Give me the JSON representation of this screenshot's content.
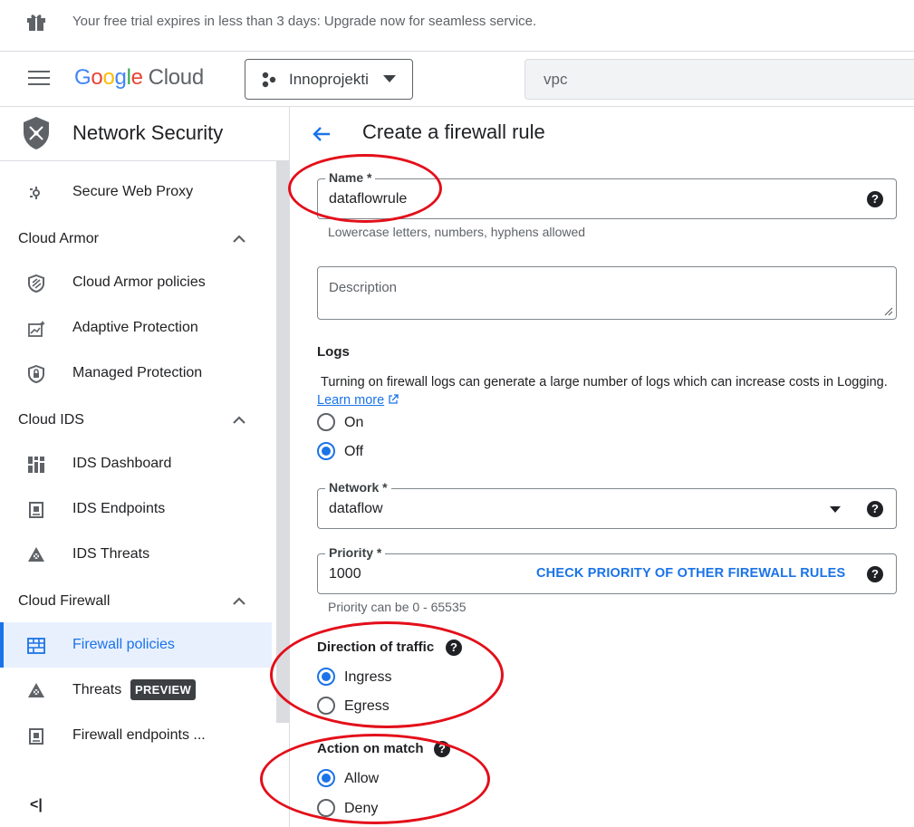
{
  "banner": {
    "text": "Your free trial expires in less than 3 days: Upgrade now for seamless service."
  },
  "header": {
    "logo_google": [
      "G",
      "o",
      "o",
      "g",
      "l",
      "e"
    ],
    "logo_cloud": "Cloud",
    "project": "Innoprojekti",
    "search_value": "vpc"
  },
  "sidebar": {
    "title": "Network Security",
    "items": [
      {
        "type": "item",
        "label": "Secure Web Proxy",
        "icon": "proxy-icon"
      },
      {
        "type": "group",
        "label": "Cloud Armor"
      },
      {
        "type": "item",
        "label": "Cloud Armor policies",
        "icon": "shield-icon"
      },
      {
        "type": "item",
        "label": "Adaptive Protection",
        "icon": "chart-sparkle-icon"
      },
      {
        "type": "item",
        "label": "Managed Protection",
        "icon": "lock-shield-icon"
      },
      {
        "type": "group",
        "label": "Cloud IDS"
      },
      {
        "type": "item",
        "label": "IDS Dashboard",
        "icon": "dashboard-icon"
      },
      {
        "type": "item",
        "label": "IDS Endpoints",
        "icon": "endpoint-icon"
      },
      {
        "type": "item",
        "label": "IDS Threats",
        "icon": "threat-icon"
      },
      {
        "type": "group",
        "label": "Cloud Firewall"
      },
      {
        "type": "item",
        "label": "Firewall policies",
        "icon": "firewall-icon",
        "active": true
      },
      {
        "type": "item",
        "label": "Threats",
        "icon": "threat-icon",
        "badge": "PREVIEW"
      },
      {
        "type": "item",
        "label": "Firewall endpoints ...",
        "icon": "endpoint-icon"
      }
    ],
    "collapse_label": "<|"
  },
  "form": {
    "page_title": "Create a firewall rule",
    "name": {
      "label": "Name *",
      "value": "dataflowrule",
      "hint": "Lowercase letters, numbers, hyphens allowed"
    },
    "description": {
      "placeholder": "Description"
    },
    "logs": {
      "label": "Logs",
      "text": "Turning on firewall logs can generate a large number of logs which can increase costs in Logging.",
      "link": "Learn more",
      "options": [
        "On",
        "Off"
      ],
      "selected": "Off"
    },
    "network": {
      "label": "Network *",
      "value": "dataflow"
    },
    "priority": {
      "label": "Priority *",
      "value": "1000",
      "action": "CHECK PRIORITY OF OTHER FIREWALL RULES",
      "hint": "Priority can be 0 - 65535"
    },
    "direction": {
      "label": "Direction of traffic",
      "options": [
        "Ingress",
        "Egress"
      ],
      "selected": "Ingress"
    },
    "action": {
      "label": "Action on match",
      "options": [
        "Allow",
        "Deny"
      ],
      "selected": "Allow"
    }
  },
  "colors": {
    "accent": "#1a73e8",
    "annotation": "#e30f1a"
  }
}
